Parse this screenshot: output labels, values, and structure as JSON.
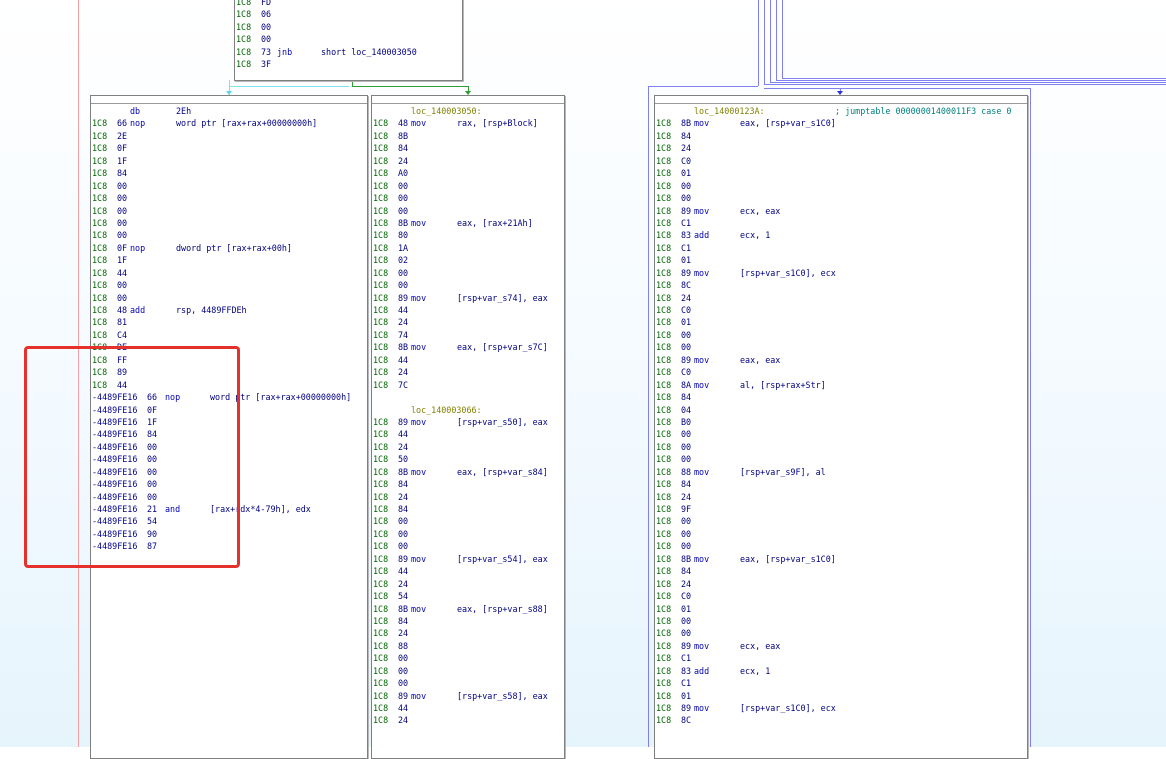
{
  "top_block": {
    "lines": [
      {
        "addr": "1C8",
        "byte": "FD",
        "mnem": "",
        "ops": ""
      },
      {
        "addr": "1C8",
        "byte": "06",
        "mnem": "",
        "ops": ""
      },
      {
        "addr": "1C8",
        "byte": "00",
        "mnem": "",
        "ops": ""
      },
      {
        "addr": "1C8",
        "byte": "00",
        "mnem": "",
        "ops": ""
      },
      {
        "addr": "1C8",
        "byte": "73",
        "mnem": "jnb",
        "ops": "short loc_140003050"
      },
      {
        "addr": "1C8",
        "byte": "3F",
        "mnem": "",
        "ops": ""
      }
    ]
  },
  "left_block": {
    "db_line": {
      "mnem": "db",
      "ops": "2Eh"
    },
    "lines": [
      {
        "addr": "1C8",
        "byte": "66",
        "mnem": "nop",
        "ops": "word ptr [rax+rax+00000000h]"
      },
      {
        "addr": "1C8",
        "byte": "2E",
        "mnem": "",
        "ops": ""
      },
      {
        "addr": "1C8",
        "byte": "0F",
        "mnem": "",
        "ops": ""
      },
      {
        "addr": "1C8",
        "byte": "1F",
        "mnem": "",
        "ops": ""
      },
      {
        "addr": "1C8",
        "byte": "84",
        "mnem": "",
        "ops": ""
      },
      {
        "addr": "1C8",
        "byte": "00",
        "mnem": "",
        "ops": ""
      },
      {
        "addr": "1C8",
        "byte": "00",
        "mnem": "",
        "ops": ""
      },
      {
        "addr": "1C8",
        "byte": "00",
        "mnem": "",
        "ops": ""
      },
      {
        "addr": "1C8",
        "byte": "00",
        "mnem": "",
        "ops": ""
      },
      {
        "addr": "1C8",
        "byte": "00",
        "mnem": "",
        "ops": ""
      },
      {
        "addr": "1C8",
        "byte": "0F",
        "mnem": "nop",
        "ops": "dword ptr [rax+rax+00h]"
      },
      {
        "addr": "1C8",
        "byte": "1F",
        "mnem": "",
        "ops": ""
      },
      {
        "addr": "1C8",
        "byte": "44",
        "mnem": "",
        "ops": ""
      },
      {
        "addr": "1C8",
        "byte": "00",
        "mnem": "",
        "ops": ""
      },
      {
        "addr": "1C8",
        "byte": "00",
        "mnem": "",
        "ops": ""
      },
      {
        "addr": "1C8",
        "byte": "48",
        "mnem": "add",
        "ops": "rsp, 4489FFDEh"
      },
      {
        "addr": "1C8",
        "byte": "81",
        "mnem": "",
        "ops": ""
      },
      {
        "addr": "1C8",
        "byte": "C4",
        "mnem": "",
        "ops": ""
      },
      {
        "addr": "1C8",
        "byte": "DE",
        "mnem": "",
        "ops": ""
      },
      {
        "addr": "1C8",
        "byte": "FF",
        "mnem": "",
        "ops": ""
      },
      {
        "addr": "1C8",
        "byte": "89",
        "mnem": "",
        "ops": ""
      },
      {
        "addr": "1C8",
        "byte": "44",
        "mnem": "",
        "ops": ""
      },
      {
        "addr": "-4489FE16",
        "byte": "66",
        "mnem": "nop",
        "ops": "word ptr [rax+rax+00000000h]"
      },
      {
        "addr": "-4489FE16",
        "byte": "0F",
        "mnem": "",
        "ops": ""
      },
      {
        "addr": "-4489FE16",
        "byte": "1F",
        "mnem": "",
        "ops": ""
      },
      {
        "addr": "-4489FE16",
        "byte": "84",
        "mnem": "",
        "ops": ""
      },
      {
        "addr": "-4489FE16",
        "byte": "00",
        "mnem": "",
        "ops": ""
      },
      {
        "addr": "-4489FE16",
        "byte": "00",
        "mnem": "",
        "ops": ""
      },
      {
        "addr": "-4489FE16",
        "byte": "00",
        "mnem": "",
        "ops": ""
      },
      {
        "addr": "-4489FE16",
        "byte": "00",
        "mnem": "",
        "ops": ""
      },
      {
        "addr": "-4489FE16",
        "byte": "00",
        "mnem": "",
        "ops": ""
      },
      {
        "addr": "-4489FE16",
        "byte": "21",
        "mnem": "and",
        "ops": "[rax+rdx*4-79h], edx"
      },
      {
        "addr": "-4489FE16",
        "byte": "54",
        "mnem": "",
        "ops": ""
      },
      {
        "addr": "-4489FE16",
        "byte": "90",
        "mnem": "",
        "ops": ""
      },
      {
        "addr": "-4489FE16",
        "byte": "87",
        "mnem": "",
        "ops": ""
      }
    ]
  },
  "middle_block": {
    "lines": [
      {
        "label": "loc_140003050:"
      },
      {
        "addr": "1C8",
        "byte": "48",
        "mnem": "mov",
        "ops": "rax, [rsp+Block]"
      },
      {
        "addr": "1C8",
        "byte": "8B",
        "mnem": "",
        "ops": ""
      },
      {
        "addr": "1C8",
        "byte": "84",
        "mnem": "",
        "ops": ""
      },
      {
        "addr": "1C8",
        "byte": "24",
        "mnem": "",
        "ops": ""
      },
      {
        "addr": "1C8",
        "byte": "A0",
        "mnem": "",
        "ops": ""
      },
      {
        "addr": "1C8",
        "byte": "00",
        "mnem": "",
        "ops": ""
      },
      {
        "addr": "1C8",
        "byte": "00",
        "mnem": "",
        "ops": ""
      },
      {
        "addr": "1C8",
        "byte": "00",
        "mnem": "",
        "ops": ""
      },
      {
        "addr": "1C8",
        "byte": "8B",
        "mnem": "mov",
        "ops": "eax, [rax+21Ah]"
      },
      {
        "addr": "1C8",
        "byte": "80",
        "mnem": "",
        "ops": ""
      },
      {
        "addr": "1C8",
        "byte": "1A",
        "mnem": "",
        "ops": ""
      },
      {
        "addr": "1C8",
        "byte": "02",
        "mnem": "",
        "ops": ""
      },
      {
        "addr": "1C8",
        "byte": "00",
        "mnem": "",
        "ops": ""
      },
      {
        "addr": "1C8",
        "byte": "00",
        "mnem": "",
        "ops": ""
      },
      {
        "addr": "1C8",
        "byte": "89",
        "mnem": "mov",
        "ops": "[rsp+var_s74], eax"
      },
      {
        "addr": "1C8",
        "byte": "44",
        "mnem": "",
        "ops": ""
      },
      {
        "addr": "1C8",
        "byte": "24",
        "mnem": "",
        "ops": ""
      },
      {
        "addr": "1C8",
        "byte": "74",
        "mnem": "",
        "ops": ""
      },
      {
        "addr": "1C8",
        "byte": "8B",
        "mnem": "mov",
        "ops": "eax, [rsp+var_s7C]"
      },
      {
        "addr": "1C8",
        "byte": "44",
        "mnem": "",
        "ops": ""
      },
      {
        "addr": "1C8",
        "byte": "24",
        "mnem": "",
        "ops": ""
      },
      {
        "addr": "1C8",
        "byte": "7C",
        "mnem": "",
        "ops": ""
      },
      {
        "blank": true
      },
      {
        "label": "loc_140003066:"
      },
      {
        "addr": "1C8",
        "byte": "89",
        "mnem": "mov",
        "ops": "[rsp+var_s50], eax"
      },
      {
        "addr": "1C8",
        "byte": "44",
        "mnem": "",
        "ops": ""
      },
      {
        "addr": "1C8",
        "byte": "24",
        "mnem": "",
        "ops": ""
      },
      {
        "addr": "1C8",
        "byte": "50",
        "mnem": "",
        "ops": ""
      },
      {
        "addr": "1C8",
        "byte": "8B",
        "mnem": "mov",
        "ops": "eax, [rsp+var_s84]"
      },
      {
        "addr": "1C8",
        "byte": "84",
        "mnem": "",
        "ops": ""
      },
      {
        "addr": "1C8",
        "byte": "24",
        "mnem": "",
        "ops": ""
      },
      {
        "addr": "1C8",
        "byte": "84",
        "mnem": "",
        "ops": ""
      },
      {
        "addr": "1C8",
        "byte": "00",
        "mnem": "",
        "ops": ""
      },
      {
        "addr": "1C8",
        "byte": "00",
        "mnem": "",
        "ops": ""
      },
      {
        "addr": "1C8",
        "byte": "00",
        "mnem": "",
        "ops": ""
      },
      {
        "addr": "1C8",
        "byte": "89",
        "mnem": "mov",
        "ops": "[rsp+var_s54], eax"
      },
      {
        "addr": "1C8",
        "byte": "44",
        "mnem": "",
        "ops": ""
      },
      {
        "addr": "1C8",
        "byte": "24",
        "mnem": "",
        "ops": ""
      },
      {
        "addr": "1C8",
        "byte": "54",
        "mnem": "",
        "ops": ""
      },
      {
        "addr": "1C8",
        "byte": "8B",
        "mnem": "mov",
        "ops": "eax, [rsp+var_s88]"
      },
      {
        "addr": "1C8",
        "byte": "84",
        "mnem": "",
        "ops": ""
      },
      {
        "addr": "1C8",
        "byte": "24",
        "mnem": "",
        "ops": ""
      },
      {
        "addr": "1C8",
        "byte": "88",
        "mnem": "",
        "ops": ""
      },
      {
        "addr": "1C8",
        "byte": "00",
        "mnem": "",
        "ops": ""
      },
      {
        "addr": "1C8",
        "byte": "00",
        "mnem": "",
        "ops": ""
      },
      {
        "addr": "1C8",
        "byte": "00",
        "mnem": "",
        "ops": ""
      },
      {
        "addr": "1C8",
        "byte": "89",
        "mnem": "mov",
        "ops": "[rsp+var_s58], eax"
      },
      {
        "addr": "1C8",
        "byte": "44",
        "mnem": "",
        "ops": ""
      },
      {
        "addr": "1C8",
        "byte": "24",
        "mnem": "",
        "ops": ""
      }
    ]
  },
  "right_block": {
    "header_label": "loc_14000123A:",
    "header_comment": "; jumptable 00000001400011F3 case 0",
    "lines": [
      {
        "addr": "1C8",
        "byte": "8B",
        "mnem": "mov",
        "ops": "eax, [rsp+var_s1C0]"
      },
      {
        "addr": "1C8",
        "byte": "84",
        "mnem": "",
        "ops": ""
      },
      {
        "addr": "1C8",
        "byte": "24",
        "mnem": "",
        "ops": ""
      },
      {
        "addr": "1C8",
        "byte": "C0",
        "mnem": "",
        "ops": ""
      },
      {
        "addr": "1C8",
        "byte": "01",
        "mnem": "",
        "ops": ""
      },
      {
        "addr": "1C8",
        "byte": "00",
        "mnem": "",
        "ops": ""
      },
      {
        "addr": "1C8",
        "byte": "00",
        "mnem": "",
        "ops": ""
      },
      {
        "addr": "1C8",
        "byte": "89",
        "mnem": "mov",
        "ops": "ecx, eax"
      },
      {
        "addr": "1C8",
        "byte": "C1",
        "mnem": "",
        "ops": ""
      },
      {
        "addr": "1C8",
        "byte": "83",
        "mnem": "add",
        "ops": "ecx, 1"
      },
      {
        "addr": "1C8",
        "byte": "C1",
        "mnem": "",
        "ops": ""
      },
      {
        "addr": "1C8",
        "byte": "01",
        "mnem": "",
        "ops": ""
      },
      {
        "addr": "1C8",
        "byte": "89",
        "mnem": "mov",
        "ops": "[rsp+var_s1C0], ecx"
      },
      {
        "addr": "1C8",
        "byte": "8C",
        "mnem": "",
        "ops": ""
      },
      {
        "addr": "1C8",
        "byte": "24",
        "mnem": "",
        "ops": ""
      },
      {
        "addr": "1C8",
        "byte": "C0",
        "mnem": "",
        "ops": ""
      },
      {
        "addr": "1C8",
        "byte": "01",
        "mnem": "",
        "ops": ""
      },
      {
        "addr": "1C8",
        "byte": "00",
        "mnem": "",
        "ops": ""
      },
      {
        "addr": "1C8",
        "byte": "00",
        "mnem": "",
        "ops": ""
      },
      {
        "addr": "1C8",
        "byte": "89",
        "mnem": "mov",
        "ops": "eax, eax"
      },
      {
        "addr": "1C8",
        "byte": "C0",
        "mnem": "",
        "ops": ""
      },
      {
        "addr": "1C8",
        "byte": "8A",
        "mnem": "mov",
        "ops": "al, [rsp+rax+Str]"
      },
      {
        "addr": "1C8",
        "byte": "84",
        "mnem": "",
        "ops": ""
      },
      {
        "addr": "1C8",
        "byte": "04",
        "mnem": "",
        "ops": ""
      },
      {
        "addr": "1C8",
        "byte": "B0",
        "mnem": "",
        "ops": ""
      },
      {
        "addr": "1C8",
        "byte": "00",
        "mnem": "",
        "ops": ""
      },
      {
        "addr": "1C8",
        "byte": "00",
        "mnem": "",
        "ops": ""
      },
      {
        "addr": "1C8",
        "byte": "00",
        "mnem": "",
        "ops": ""
      },
      {
        "addr": "1C8",
        "byte": "88",
        "mnem": "mov",
        "ops": "[rsp+var_s9F], al"
      },
      {
        "addr": "1C8",
        "byte": "84",
        "mnem": "",
        "ops": ""
      },
      {
        "addr": "1C8",
        "byte": "24",
        "mnem": "",
        "ops": ""
      },
      {
        "addr": "1C8",
        "byte": "9F",
        "mnem": "",
        "ops": ""
      },
      {
        "addr": "1C8",
        "byte": "00",
        "mnem": "",
        "ops": ""
      },
      {
        "addr": "1C8",
        "byte": "00",
        "mnem": "",
        "ops": ""
      },
      {
        "addr": "1C8",
        "byte": "00",
        "mnem": "",
        "ops": ""
      },
      {
        "addr": "1C8",
        "byte": "8B",
        "mnem": "mov",
        "ops": "eax, [rsp+var_s1C0]"
      },
      {
        "addr": "1C8",
        "byte": "84",
        "mnem": "",
        "ops": ""
      },
      {
        "addr": "1C8",
        "byte": "24",
        "mnem": "",
        "ops": ""
      },
      {
        "addr": "1C8",
        "byte": "C0",
        "mnem": "",
        "ops": ""
      },
      {
        "addr": "1C8",
        "byte": "01",
        "mnem": "",
        "ops": ""
      },
      {
        "addr": "1C8",
        "byte": "00",
        "mnem": "",
        "ops": ""
      },
      {
        "addr": "1C8",
        "byte": "00",
        "mnem": "",
        "ops": ""
      },
      {
        "addr": "1C8",
        "byte": "89",
        "mnem": "mov",
        "ops": "ecx, eax"
      },
      {
        "addr": "1C8",
        "byte": "C1",
        "mnem": "",
        "ops": ""
      },
      {
        "addr": "1C8",
        "byte": "83",
        "mnem": "add",
        "ops": "ecx, 1"
      },
      {
        "addr": "1C8",
        "byte": "C1",
        "mnem": "",
        "ops": ""
      },
      {
        "addr": "1C8",
        "byte": "01",
        "mnem": "",
        "ops": ""
      },
      {
        "addr": "1C8",
        "byte": "89",
        "mnem": "mov",
        "ops": "[rsp+var_s1C0], ecx"
      },
      {
        "addr": "1C8",
        "byte": "8C",
        "mnem": "",
        "ops": ""
      }
    ]
  },
  "colors": {
    "address": "#006400",
    "mnemonic": "#0000b0",
    "label": "#808000",
    "comment": "#008080",
    "highlight_box": "#e5312b",
    "edge_true": "#2e9e2e",
    "edge_flow": "#5ad6e6",
    "edge_jump": "#8080f0"
  }
}
